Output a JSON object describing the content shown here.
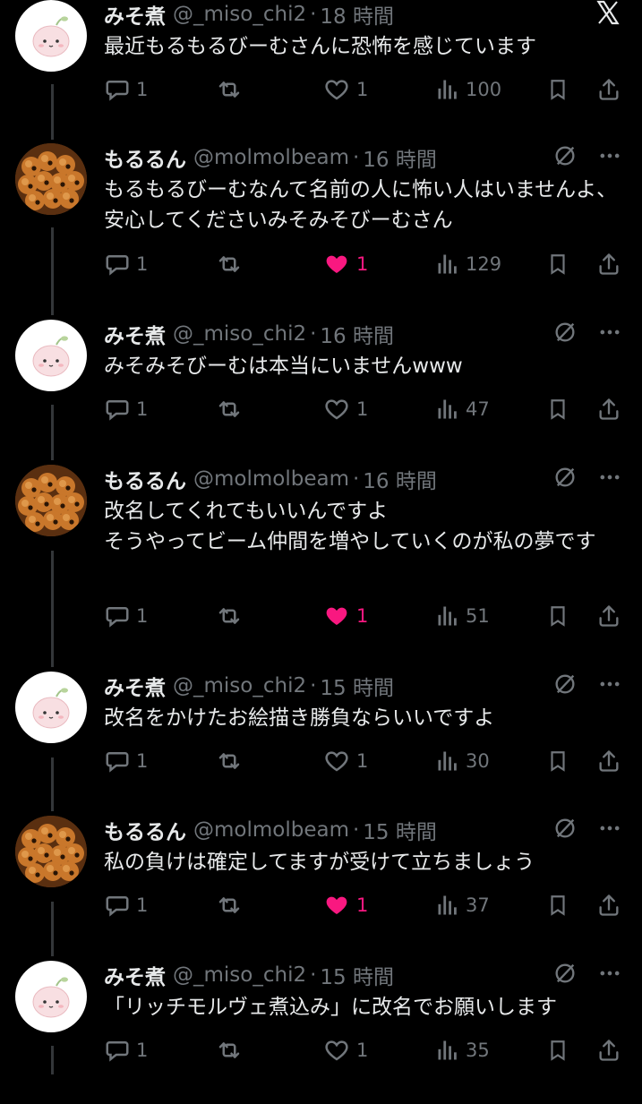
{
  "tweets": [
    {
      "name": "みそ煮",
      "handle": "@_miso_chi2",
      "time": "18 時間",
      "text": "最近もるもるびーむさんに恐怖を感じています",
      "replies": "1",
      "reposts": "",
      "likes": "1",
      "liked": false,
      "views": "100",
      "top_icon": "x-logo-icon"
    },
    {
      "name": "もるるん",
      "handle": "@molmolbeam",
      "time": "16 時間",
      "text": "もるもるびーむなんて名前の人に怖い人はいませんよ、安心してくださいみそみそびーむさん",
      "replies": "1",
      "reposts": "",
      "likes": "1",
      "liked": true,
      "views": "129",
      "top_icon": "grok-icon"
    },
    {
      "name": "みそ煮",
      "handle": "@_miso_chi2",
      "time": "16 時間",
      "text": "みそみそびーむは本当にいませんwww",
      "replies": "1",
      "reposts": "",
      "likes": "1",
      "liked": false,
      "views": "47",
      "top_icon": "grok-icon"
    },
    {
      "name": "もるるん",
      "handle": "@molmolbeam",
      "time": "16 時間",
      "text": "改名してくれてもいいんですよ\nそうやってビーム仲間を増やしていくのが私の夢です",
      "replies": "1",
      "reposts": "",
      "likes": "1",
      "liked": true,
      "views": "51",
      "top_icon": "grok-icon"
    },
    {
      "name": "みそ煮",
      "handle": "@_miso_chi2",
      "time": "15 時間",
      "text": "改名をかけたお絵描き勝負ならいいですよ",
      "replies": "1",
      "reposts": "",
      "likes": "1",
      "liked": false,
      "views": "30",
      "top_icon": "grok-icon"
    },
    {
      "name": "もるるん",
      "handle": "@molmolbeam",
      "time": "15 時間",
      "text": "私の負けは確定してますが受けて立ちましょう",
      "replies": "1",
      "reposts": "",
      "likes": "1",
      "liked": true,
      "views": "37",
      "top_icon": "grok-icon"
    },
    {
      "name": "みそ煮",
      "handle": "@_miso_chi2",
      "time": "15 時間",
      "text": "「リッチモルヴェ煮込み」に改名でお願いします",
      "replies": "1",
      "reposts": "",
      "likes": "1",
      "liked": false,
      "views": "35",
      "top_icon": "grok-icon"
    }
  ],
  "colors": {
    "background": "#000000",
    "text": "#e7e9ea",
    "muted": "#71767b",
    "like": "#f91880"
  }
}
